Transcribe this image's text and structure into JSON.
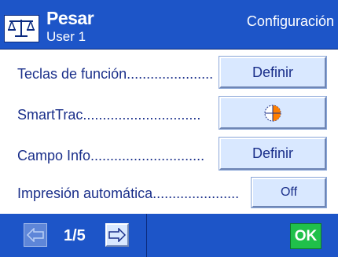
{
  "header": {
    "title": "Pesar",
    "user": "User 1",
    "section": "Configuración",
    "icon": "scale-icon"
  },
  "rows": [
    {
      "label": "Teclas de función.......................",
      "button": "Definir"
    },
    {
      "label": "SmartTrac..............................",
      "button": "",
      "button_icon": "smarttrac-icon"
    },
    {
      "label": "Campo Info.............................",
      "button": "Definir"
    },
    {
      "label": "Impresión automática......................",
      "button": "Off"
    }
  ],
  "footer": {
    "page": "1/5",
    "prev_icon": "arrow-left-icon",
    "next_icon": "arrow-right-icon",
    "ok_label": "OK"
  },
  "colors": {
    "header_bg": "#1d55c8",
    "button_bg": "#d9e8ff",
    "label_text": "#1a2f8a",
    "ok_green": "#20c04a",
    "smarttrac_orange": "#ff7f00"
  }
}
